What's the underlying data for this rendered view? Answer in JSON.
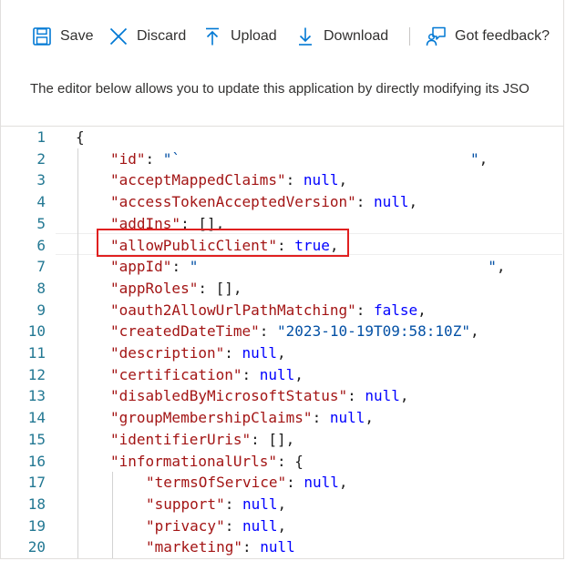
{
  "toolbar": {
    "save_label": "Save",
    "discard_label": "Discard",
    "upload_label": "Upload",
    "download_label": "Download",
    "feedback_label": "Got feedback?",
    "icons": {
      "save": "floppy-disk-icon",
      "discard": "x-icon",
      "upload": "arrow-up-icon",
      "download": "arrow-down-icon",
      "feedback": "person-feedback-icon"
    },
    "accent_color": "#0078d4"
  },
  "description": "The editor below allows you to update this application by directly modifying its JSO",
  "editor": {
    "line_numbers": [
      "1",
      "2",
      "3",
      "4",
      "5",
      "6",
      "7",
      "8",
      "9",
      "10",
      "11",
      "12",
      "13",
      "14",
      "15",
      "16",
      "17",
      "18",
      "19",
      "20"
    ],
    "lines": [
      {
        "key": "",
        "open": "{"
      },
      {
        "key": "\"id\"",
        "sep": ": ",
        "value": "\"`",
        "value_type": "string",
        "tail_pad": "                                 ",
        "suffix": "\","
      },
      {
        "key": "\"acceptMappedClaims\"",
        "sep": ": ",
        "value": "null",
        "value_type": "keyword",
        "suffix": ","
      },
      {
        "key": "\"accessTokenAcceptedVersion\"",
        "sep": ": ",
        "value": "null",
        "value_type": "keyword",
        "suffix": ","
      },
      {
        "key": "\"addIns\"",
        "sep": ": ",
        "value": "[]",
        "value_type": "punct",
        "suffix": ","
      },
      {
        "key": "\"allowPublicClient\"",
        "sep": ": ",
        "value": "true",
        "value_type": "keyword",
        "suffix": ","
      },
      {
        "key": "\"appId\"",
        "sep": ": ",
        "value": "\"",
        "value_type": "string",
        "tail_pad": "                                 ",
        "suffix": "\","
      },
      {
        "key": "\"appRoles\"",
        "sep": ": ",
        "value": "[]",
        "value_type": "punct",
        "suffix": ","
      },
      {
        "key": "\"oauth2AllowUrlPathMatching\"",
        "sep": ": ",
        "value": "false",
        "value_type": "keyword",
        "suffix": ","
      },
      {
        "key": "\"createdDateTime\"",
        "sep": ": ",
        "value": "\"2023-10-19T09:58:10Z\"",
        "value_type": "string",
        "suffix": ","
      },
      {
        "key": "\"description\"",
        "sep": ": ",
        "value": "null",
        "value_type": "keyword",
        "suffix": ","
      },
      {
        "key": "\"certification\"",
        "sep": ": ",
        "value": "null",
        "value_type": "keyword",
        "suffix": ","
      },
      {
        "key": "\"disabledByMicrosoftStatus\"",
        "sep": ": ",
        "value": "null",
        "value_type": "keyword",
        "suffix": ","
      },
      {
        "key": "\"groupMembershipClaims\"",
        "sep": ": ",
        "value": "null",
        "value_type": "keyword",
        "suffix": ","
      },
      {
        "key": "\"identifierUris\"",
        "sep": ": ",
        "value": "[]",
        "value_type": "punct",
        "suffix": ","
      },
      {
        "key": "\"informationalUrls\"",
        "sep": ": ",
        "value": "{",
        "value_type": "punct",
        "suffix": ""
      },
      {
        "key": "\"termsOfService\"",
        "sep": ": ",
        "value": "null",
        "value_type": "keyword",
        "suffix": ","
      },
      {
        "key": "\"support\"",
        "sep": ": ",
        "value": "null",
        "value_type": "keyword",
        "suffix": ","
      },
      {
        "key": "\"privacy\"",
        "sep": ": ",
        "value": "null",
        "value_type": "keyword",
        "suffix": ","
      },
      {
        "key": "\"marketing\"",
        "sep": ": ",
        "value": "null",
        "value_type": "keyword",
        "suffix": ""
      }
    ],
    "highlighted_line": "6",
    "colors": {
      "key": "#a31515",
      "string": "#0451a5",
      "keyword": "#0000ff",
      "line_number": "#237893",
      "highlight_box": "#e02020"
    }
  }
}
